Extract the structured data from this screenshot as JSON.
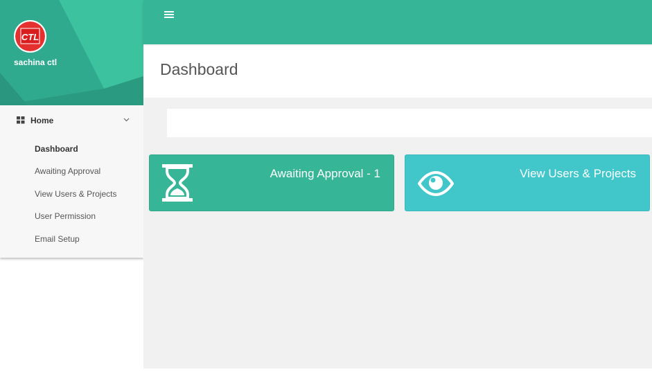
{
  "user": {
    "name": "sachina ctl",
    "logo_text": "CTL"
  },
  "sidebar": {
    "home_label": "Home",
    "items": [
      {
        "label": "Dashboard",
        "active": true
      },
      {
        "label": "Awaiting Approval",
        "active": false
      },
      {
        "label": "View Users & Projects",
        "active": false
      },
      {
        "label": "User Permission",
        "active": false
      },
      {
        "label": "Email Setup",
        "active": false
      }
    ]
  },
  "page": {
    "title": "Dashboard"
  },
  "cards": [
    {
      "title": "Awaiting Approval - 1",
      "icon": "hourglass-icon",
      "color": "#36b597"
    },
    {
      "title": "View Users & Projects",
      "icon": "eye-icon",
      "color": "#41c6c9"
    }
  ],
  "colors": {
    "primary": "#36b597",
    "accent": "#41c6c9",
    "content_bg": "#f1f1f1"
  }
}
